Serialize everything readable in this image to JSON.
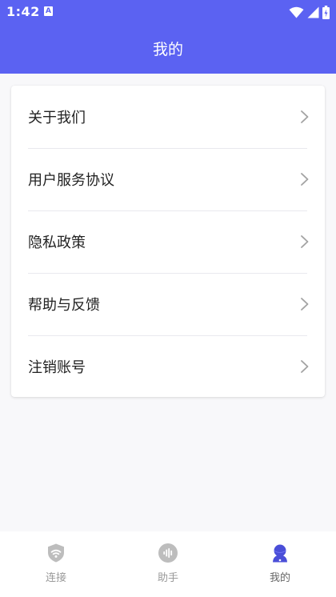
{
  "status_bar": {
    "time": "1:42",
    "notification": "A"
  },
  "header": {
    "title": "我的"
  },
  "menu": {
    "items": [
      {
        "label": "关于我们"
      },
      {
        "label": "用户服务协议"
      },
      {
        "label": "隐私政策"
      },
      {
        "label": "帮助与反馈"
      },
      {
        "label": "注销账号"
      }
    ]
  },
  "bottom_nav": {
    "items": [
      {
        "label": "连接",
        "icon": "shield-wifi-icon",
        "active": false
      },
      {
        "label": "助手",
        "icon": "assistant-voice-icon",
        "active": false
      },
      {
        "label": "我的",
        "icon": "profile-icon",
        "active": true
      }
    ]
  },
  "colors": {
    "brand": "#5b62f2",
    "inactive_icon": "#bdbdbd",
    "active_icon": "#4a4ed8"
  }
}
